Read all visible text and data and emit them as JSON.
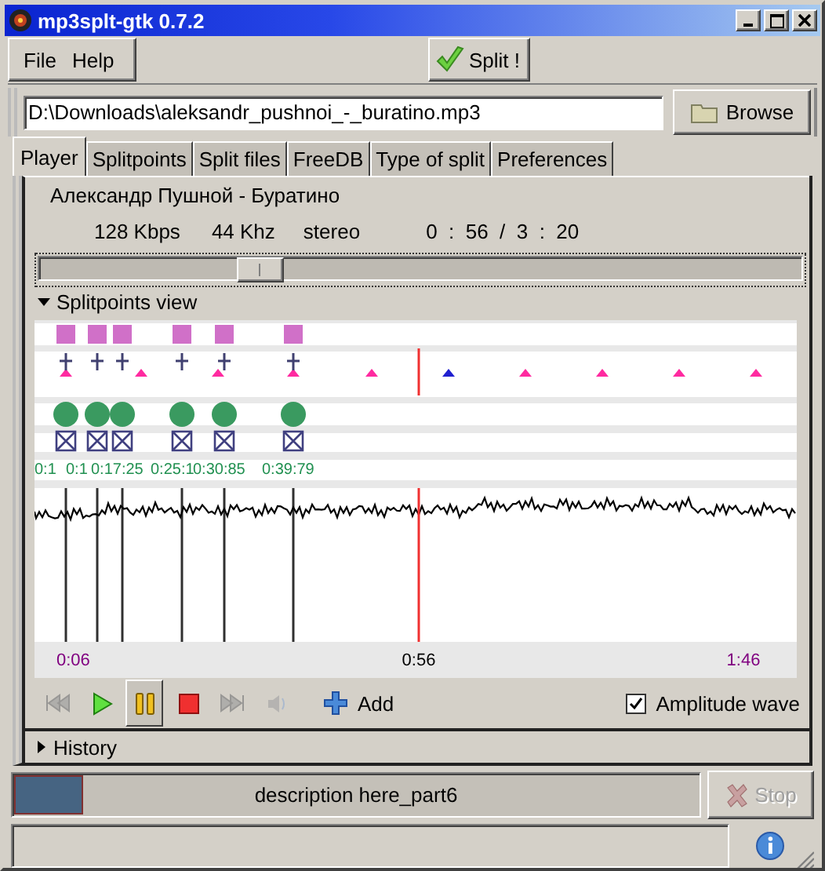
{
  "window": {
    "title": "mp3splt-gtk 0.7.2"
  },
  "menu": [
    "File",
    "Help"
  ],
  "split_button": {
    "label": "Split !"
  },
  "file_field": {
    "value": "D:\\Downloads\\aleksandr_pushnoi_-_buratino.mp3"
  },
  "browse_button": {
    "label": "Browse"
  },
  "tabs": [
    {
      "label": "Player",
      "selected": true
    },
    {
      "label": "Splitpoints",
      "selected": false
    },
    {
      "label": "Split files",
      "selected": false
    },
    {
      "label": "FreeDB",
      "selected": false
    },
    {
      "label": "Type of split",
      "selected": false
    },
    {
      "label": "Preferences",
      "selected": false
    }
  ],
  "player": {
    "song": "Александр Пушной - Буратино",
    "bitrate": "128 Kbps",
    "frequency": "44 Khz",
    "mode": "stereo",
    "time": "0  :  56  /  3  :  20",
    "position": {
      "level": 0.29
    }
  },
  "splitpoints_view": {
    "label": "Splitpoints view",
    "expanded": true,
    "splitpoints": [
      {
        "label": "0:1"
      },
      {
        "label": "0:1"
      },
      {
        "label": "0:17:25"
      },
      {
        "label": "0:25:1"
      },
      {
        "label": "0:30:85"
      },
      {
        "label": "0:39:79"
      }
    ],
    "time_labels": [
      {
        "label": "0:06",
        "color": "#800080"
      },
      {
        "label": "0:56",
        "color": "#000000"
      },
      {
        "label": "1:46",
        "color": "#800080"
      }
    ]
  },
  "controls": [
    {
      "kind": "previous",
      "disabled": true,
      "pressed": false
    },
    {
      "kind": "play",
      "disabled": false,
      "pressed": false
    },
    {
      "kind": "pause",
      "disabled": false,
      "pressed": true
    },
    {
      "kind": "stop",
      "disabled": false,
      "pressed": false
    },
    {
      "kind": "next",
      "disabled": true,
      "pressed": false
    },
    {
      "kind": "volume",
      "disabled": true,
      "pressed": false
    }
  ],
  "add_button": {
    "label": "Add"
  },
  "amplitude_wave": {
    "label": "Amplitude wave",
    "checked": true
  },
  "history": {
    "label": "History",
    "expanded": false
  },
  "progress": {
    "label": "description here_part6",
    "level": 0.1
  },
  "stop_button": {
    "label": "Stop",
    "disabled": true
  }
}
